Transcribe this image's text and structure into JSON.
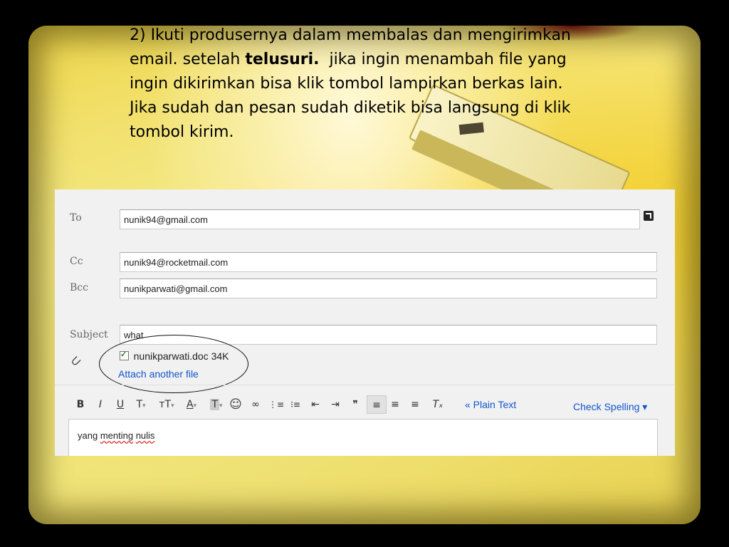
{
  "instruction": {
    "line1": "2) Ikuti produsernya dalam membalas dan mengirimkan",
    "line2_before": "email. setelah ",
    "line2_bold": "telusuri.",
    "line2_after": "  jika ingin menambah file yang",
    "line3": "ingin dikirimkan bisa klik tombol lampirkan berkas lain.",
    "line4": "Jika sudah dan pesan sudah diketik bisa langsung di klik",
    "line5": "tombol kirim."
  },
  "compose": {
    "to_label": "To",
    "to_value": "nunik94@gmail.com",
    "cc_label": "Cc",
    "cc_value": "nunik94@rocketmail.com",
    "bcc_label": "Bcc",
    "bcc_value": "nunikparwati@gmail.com",
    "subject_label": "Subject",
    "subject_value": "what",
    "attachment_name": "nunikparwati.doc 34K",
    "attach_another": "Attach another file",
    "toolbar": {
      "bold": "B",
      "italic": "I",
      "underline": "U",
      "font": "T",
      "size": "тT",
      "text_color": "A",
      "highlight": "T",
      "emoji": "☺",
      "link": "∞",
      "numbered_list": "⋮≡",
      "bullet_list": "⁝≡",
      "indent_less": "⇤",
      "indent_more": "⇥",
      "quote": "❞",
      "align_left": "≡",
      "align_center": "≡",
      "align_right": "≡",
      "remove_format": "Tₓ",
      "plain_text": "« Plain Text",
      "check_spelling": "Check Spelling ▾"
    },
    "body_prefix": "yang ",
    "body_word1": "menting",
    "body_space": " ",
    "body_word2": "nulis"
  },
  "colors": {
    "link": "#1155cc",
    "slide_yellow": "#f1e275"
  }
}
